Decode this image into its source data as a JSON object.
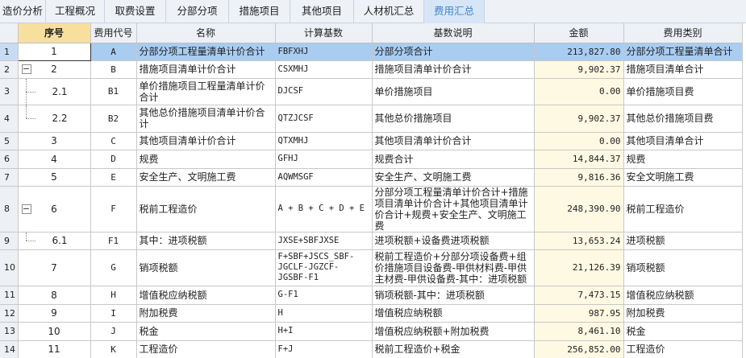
{
  "tabs": [
    {
      "label": "造价分析",
      "width": 57
    },
    {
      "label": "工程概况",
      "width": 73
    },
    {
      "label": "取费设置",
      "width": 76
    },
    {
      "label": "分部分项",
      "width": 78
    },
    {
      "label": "措施项目",
      "width": 76
    },
    {
      "label": "其他项目",
      "width": 79
    },
    {
      "label": "人材机汇总",
      "width": 87
    },
    {
      "label": "费用汇总",
      "width": 75
    }
  ],
  "active_tab": 7,
  "table": {
    "headers": [
      "",
      "序号",
      "费用代号",
      "名称",
      "计算基数",
      "基数说明",
      "金额",
      "费用类别"
    ],
    "rows": [
      {
        "idx": "1",
        "seq": "1",
        "code": "A",
        "name": "分部分项工程量清单计价合计",
        "basis": "FBFXHJ",
        "desc": "分部分项合计",
        "amount": "213,827.80",
        "category": "分部分项工程量清单合计",
        "level": 0,
        "selected": true
      },
      {
        "idx": "2",
        "seq": "2",
        "code": "B",
        "name": "措施项目清单计价合计",
        "basis": "CSXMHJ",
        "desc": "措施项目清单计价合计",
        "amount": "9,902.37",
        "category": "措施项目清单合计",
        "level": 0,
        "toggle": "−"
      },
      {
        "idx": "3",
        "seq": "2.1",
        "code": "B1",
        "name": "单价措施项目工程量清单计价合计",
        "basis": "DJCSF",
        "desc": "单价措施项目",
        "amount": "0.00",
        "category": "单价措施项目费",
        "level": 1
      },
      {
        "idx": "4",
        "seq": "2.2",
        "code": "B2",
        "name": "其他总价措施项目清单计价合计",
        "basis": "QTZJCSF",
        "desc": "其他总价措施项目",
        "amount": "9,902.37",
        "category": "其他总价措施项目费",
        "level": 1,
        "last": true
      },
      {
        "idx": "5",
        "seq": "3",
        "code": "C",
        "name": "其他项目清单计价合计",
        "basis": "QTXMHJ",
        "desc": "其他项目清单计价合计",
        "amount": "0.00",
        "category": "其他项目清单合计",
        "level": 0
      },
      {
        "idx": "6",
        "seq": "4",
        "code": "D",
        "name": "规费",
        "basis": "GFHJ",
        "desc": "规费合计",
        "amount": "14,844.37",
        "category": "规费",
        "level": 0
      },
      {
        "idx": "7",
        "seq": "5",
        "code": "E",
        "name": "安全生产、文明施工费",
        "basis": "AQWMSGF",
        "desc": "安全生产、文明施工费",
        "amount": "9,816.36",
        "category": "安全文明施工费",
        "level": 0
      },
      {
        "idx": "8",
        "seq": "6",
        "code": "F",
        "name": "税前工程造价",
        "basis": "A + B + C + D + E",
        "desc": "分部分项工程量清单计价合计+措施项目清单计价合计+其他项目清单计价合计+规费+安全生产、文明施工费",
        "amount": "248,390.90",
        "category": "税前工程造价",
        "level": 0,
        "toggle": "−"
      },
      {
        "idx": "9",
        "seq": "6.1",
        "code": "F1",
        "name": "其中：进项税额",
        "basis": "JXSE+SBFJXSE",
        "desc": "进项税额+设备费进项税额",
        "amount": "13,653.24",
        "category": "进项税额",
        "level": 1,
        "last": true
      },
      {
        "idx": "10",
        "seq": "7",
        "code": "G",
        "name": "销项税额",
        "basis": "F+SBF+JSCS_SBF-JGCLF-JGZCF-JGSBF-F1",
        "desc": "税前工程造价+分部分项设备费+组价措施项目设备费-甲供材料费-甲供主材费-甲供设备费-其中：进项税额",
        "amount": "21,126.39",
        "category": "销项税额",
        "level": 0
      },
      {
        "idx": "11",
        "seq": "8",
        "code": "H",
        "name": "增值税应纳税额",
        "basis": "G-F1",
        "desc": "销项税额-其中：进项税额",
        "amount": "7,473.15",
        "category": "增值税应纳税额",
        "level": 0
      },
      {
        "idx": "12",
        "seq": "9",
        "code": "I",
        "name": "附加税费",
        "basis": "H",
        "desc": "增值税应纳税额",
        "amount": "987.95",
        "category": "附加税费",
        "level": 0
      },
      {
        "idx": "13",
        "seq": "10",
        "code": "J",
        "name": "税金",
        "basis": "H+I",
        "desc": "增值税应纳税额+附加税费",
        "amount": "8,461.10",
        "category": "税金",
        "level": 0
      },
      {
        "idx": "14",
        "seq": "11",
        "code": "K",
        "name": "工程造价",
        "basis": "F+J",
        "desc": "税前工程造价+税金",
        "amount": "256,852.00",
        "category": "工程造价",
        "level": 0
      }
    ]
  },
  "colors": {
    "selected_row": "#a9ccf1",
    "amount_bg": "#fdf9e3",
    "seq_header_bg": "#f7df9e",
    "active_tab_text": "#3c86c9"
  },
  "icons": {
    "tree_toggle": "collapse-minus-icon"
  }
}
